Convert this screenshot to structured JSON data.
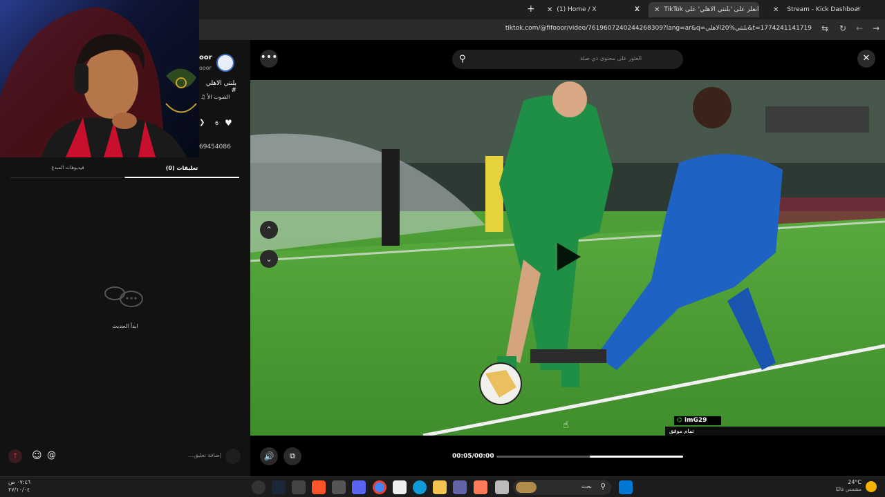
{
  "tabs": [
    {
      "label": "Stream - Kick Dashboard"
    },
    {
      "label": "اتعلر على 'بلنتي الاهلي' على TikTok"
    },
    {
      "label": "(1) Home / X"
    }
  ],
  "address": {
    "url": "tiktok.com/@fifooor/video/7619607240244268309?lang=ar&q=بلنتي%20الاهلي&t=1774241141719"
  },
  "creator": {
    "name_partial": "oor",
    "handle_partial": "ooor",
    "caption_partial": "بلنتي الاهلي #",
    "sound_partial": "الصوت الأ",
    "like_count": "6",
    "id_partial": "69454086"
  },
  "panel_tabs": {
    "comments": "تعليقات (0)",
    "creator_videos": "فيديوهات المبدع"
  },
  "empty_state": {
    "text": "ابدأ الحديث"
  },
  "comment_box": {
    "placeholder": "إضافة تعليق..."
  },
  "video": {
    "search_placeholder": "العثور على محتوى ذي صلة",
    "time": "00:05/00:00",
    "progress": 0.5
  },
  "overlay": {
    "username": "imG29",
    "message": "تمام موفق"
  },
  "taskbar": {
    "time": "٠٧:٤٦ ص",
    "date": "٢٧/١٠/٠٤",
    "search": "بحث",
    "temp": "24°C",
    "weather": "مشمس غالبًا"
  }
}
